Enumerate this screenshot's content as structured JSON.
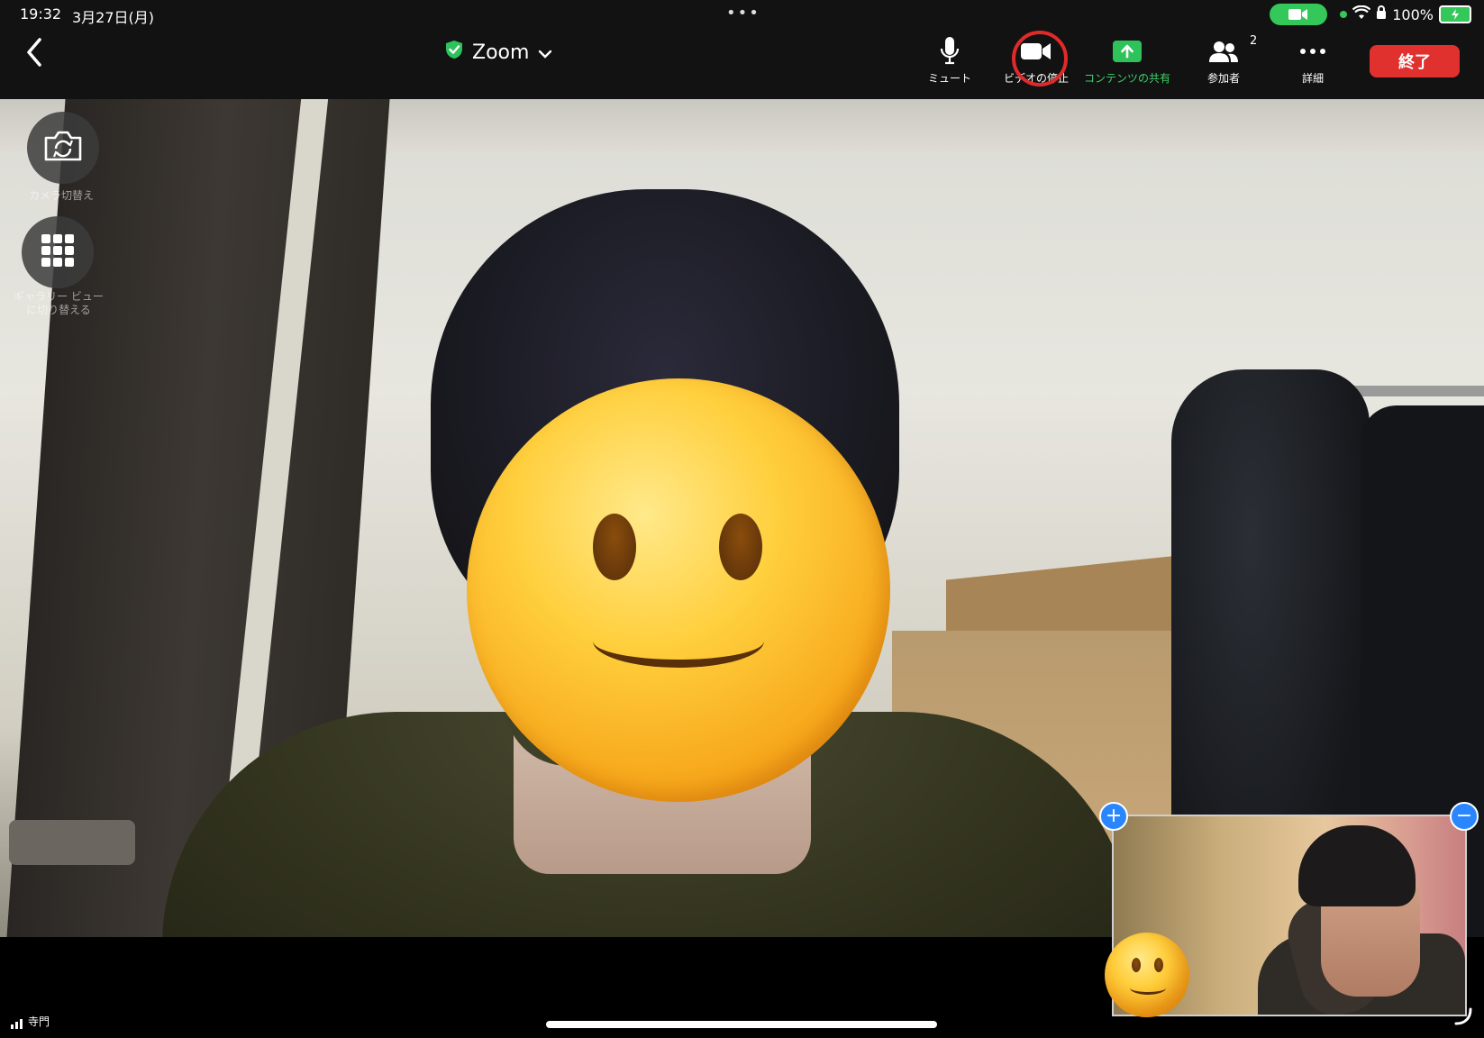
{
  "status_bar": {
    "time": "19:32",
    "date": "3月27日(月)",
    "more": "•••",
    "battery": "100%"
  },
  "toolbar": {
    "title": "Zoom",
    "mute_label": "ミュート",
    "video_label": "ビデオの停止",
    "share_label": "コンテンツの共有",
    "participants_label": "参加者",
    "participants_count": "2",
    "more_label": "詳細",
    "end_label": "終了"
  },
  "side_controls": {
    "camera_switch_label": "カメラ切替え",
    "gallery_label": "ギャラリー ビュー\nに切り替える"
  },
  "pip": {
    "expand": "+",
    "collapse": "−"
  },
  "bottom": {
    "signal_label": "寺門"
  },
  "icons": {
    "back": "chevron-left-icon",
    "shield": "shield-check-icon",
    "dropdown": "chevron-down-icon",
    "mic": "microphone-icon",
    "video": "video-camera-icon",
    "share": "share-screen-icon",
    "participants": "participants-icon",
    "more": "more-icon",
    "camera_switch": "camera-switch-icon",
    "gallery": "grid-icon"
  },
  "colors": {
    "accent_green": "#3fd06a",
    "end_red": "#e0312f",
    "highlight_ring": "#e02a2a",
    "pip_button": "#2a86ff"
  }
}
